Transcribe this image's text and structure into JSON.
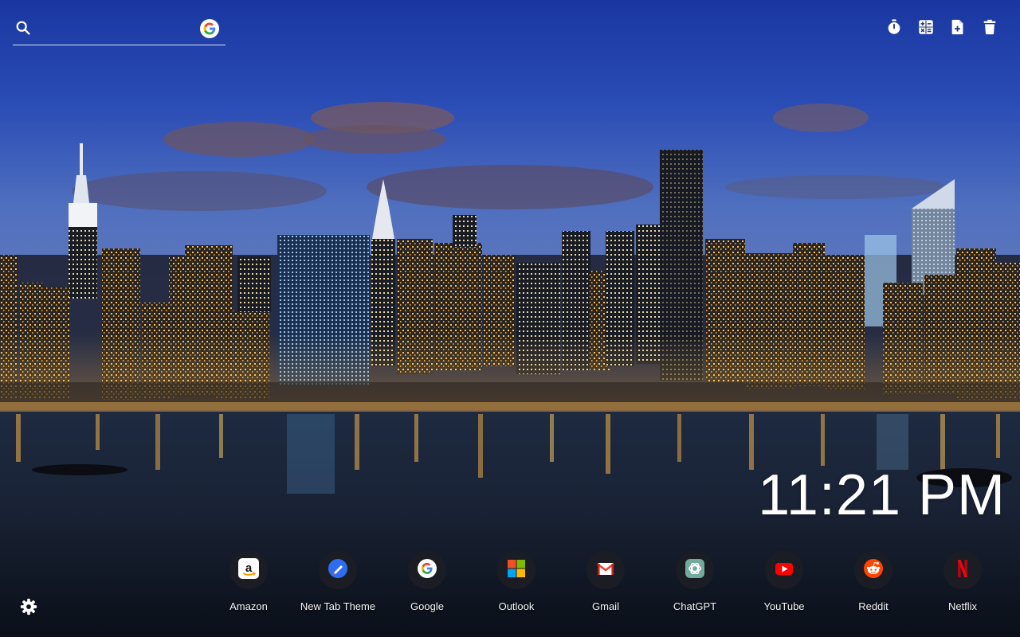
{
  "search": {
    "placeholder": "",
    "value": "",
    "icon": "search-icon",
    "engine_icon": "google-icon"
  },
  "toolbar": {
    "buttons": [
      {
        "icon": "timer-icon"
      },
      {
        "icon": "calculator-icon"
      },
      {
        "icon": "new-note-icon"
      },
      {
        "icon": "trash-icon"
      }
    ]
  },
  "clock": {
    "time": "11:21 PM"
  },
  "shortcuts": [
    {
      "label": "Amazon",
      "icon": "amazon-icon"
    },
    {
      "label": "New Tab Theme",
      "icon": "new-tab-theme-icon"
    },
    {
      "label": "Google",
      "icon": "google-icon"
    },
    {
      "label": "Outlook",
      "icon": "outlook-icon"
    },
    {
      "label": "Gmail",
      "icon": "gmail-icon"
    },
    {
      "label": "ChatGPT",
      "icon": "chatgpt-icon"
    },
    {
      "label": "YouTube",
      "icon": "youtube-icon"
    },
    {
      "label": "Reddit",
      "icon": "reddit-icon"
    },
    {
      "label": "Netflix",
      "icon": "netflix-icon"
    }
  ],
  "settings": {
    "icon": "gear-icon"
  },
  "colors": {
    "sky_top": "#1a3a9e",
    "sky_mid": "#3b5fb8",
    "water": "#121a2a",
    "city_light": "#ffb84a",
    "text": "#ffffff"
  }
}
